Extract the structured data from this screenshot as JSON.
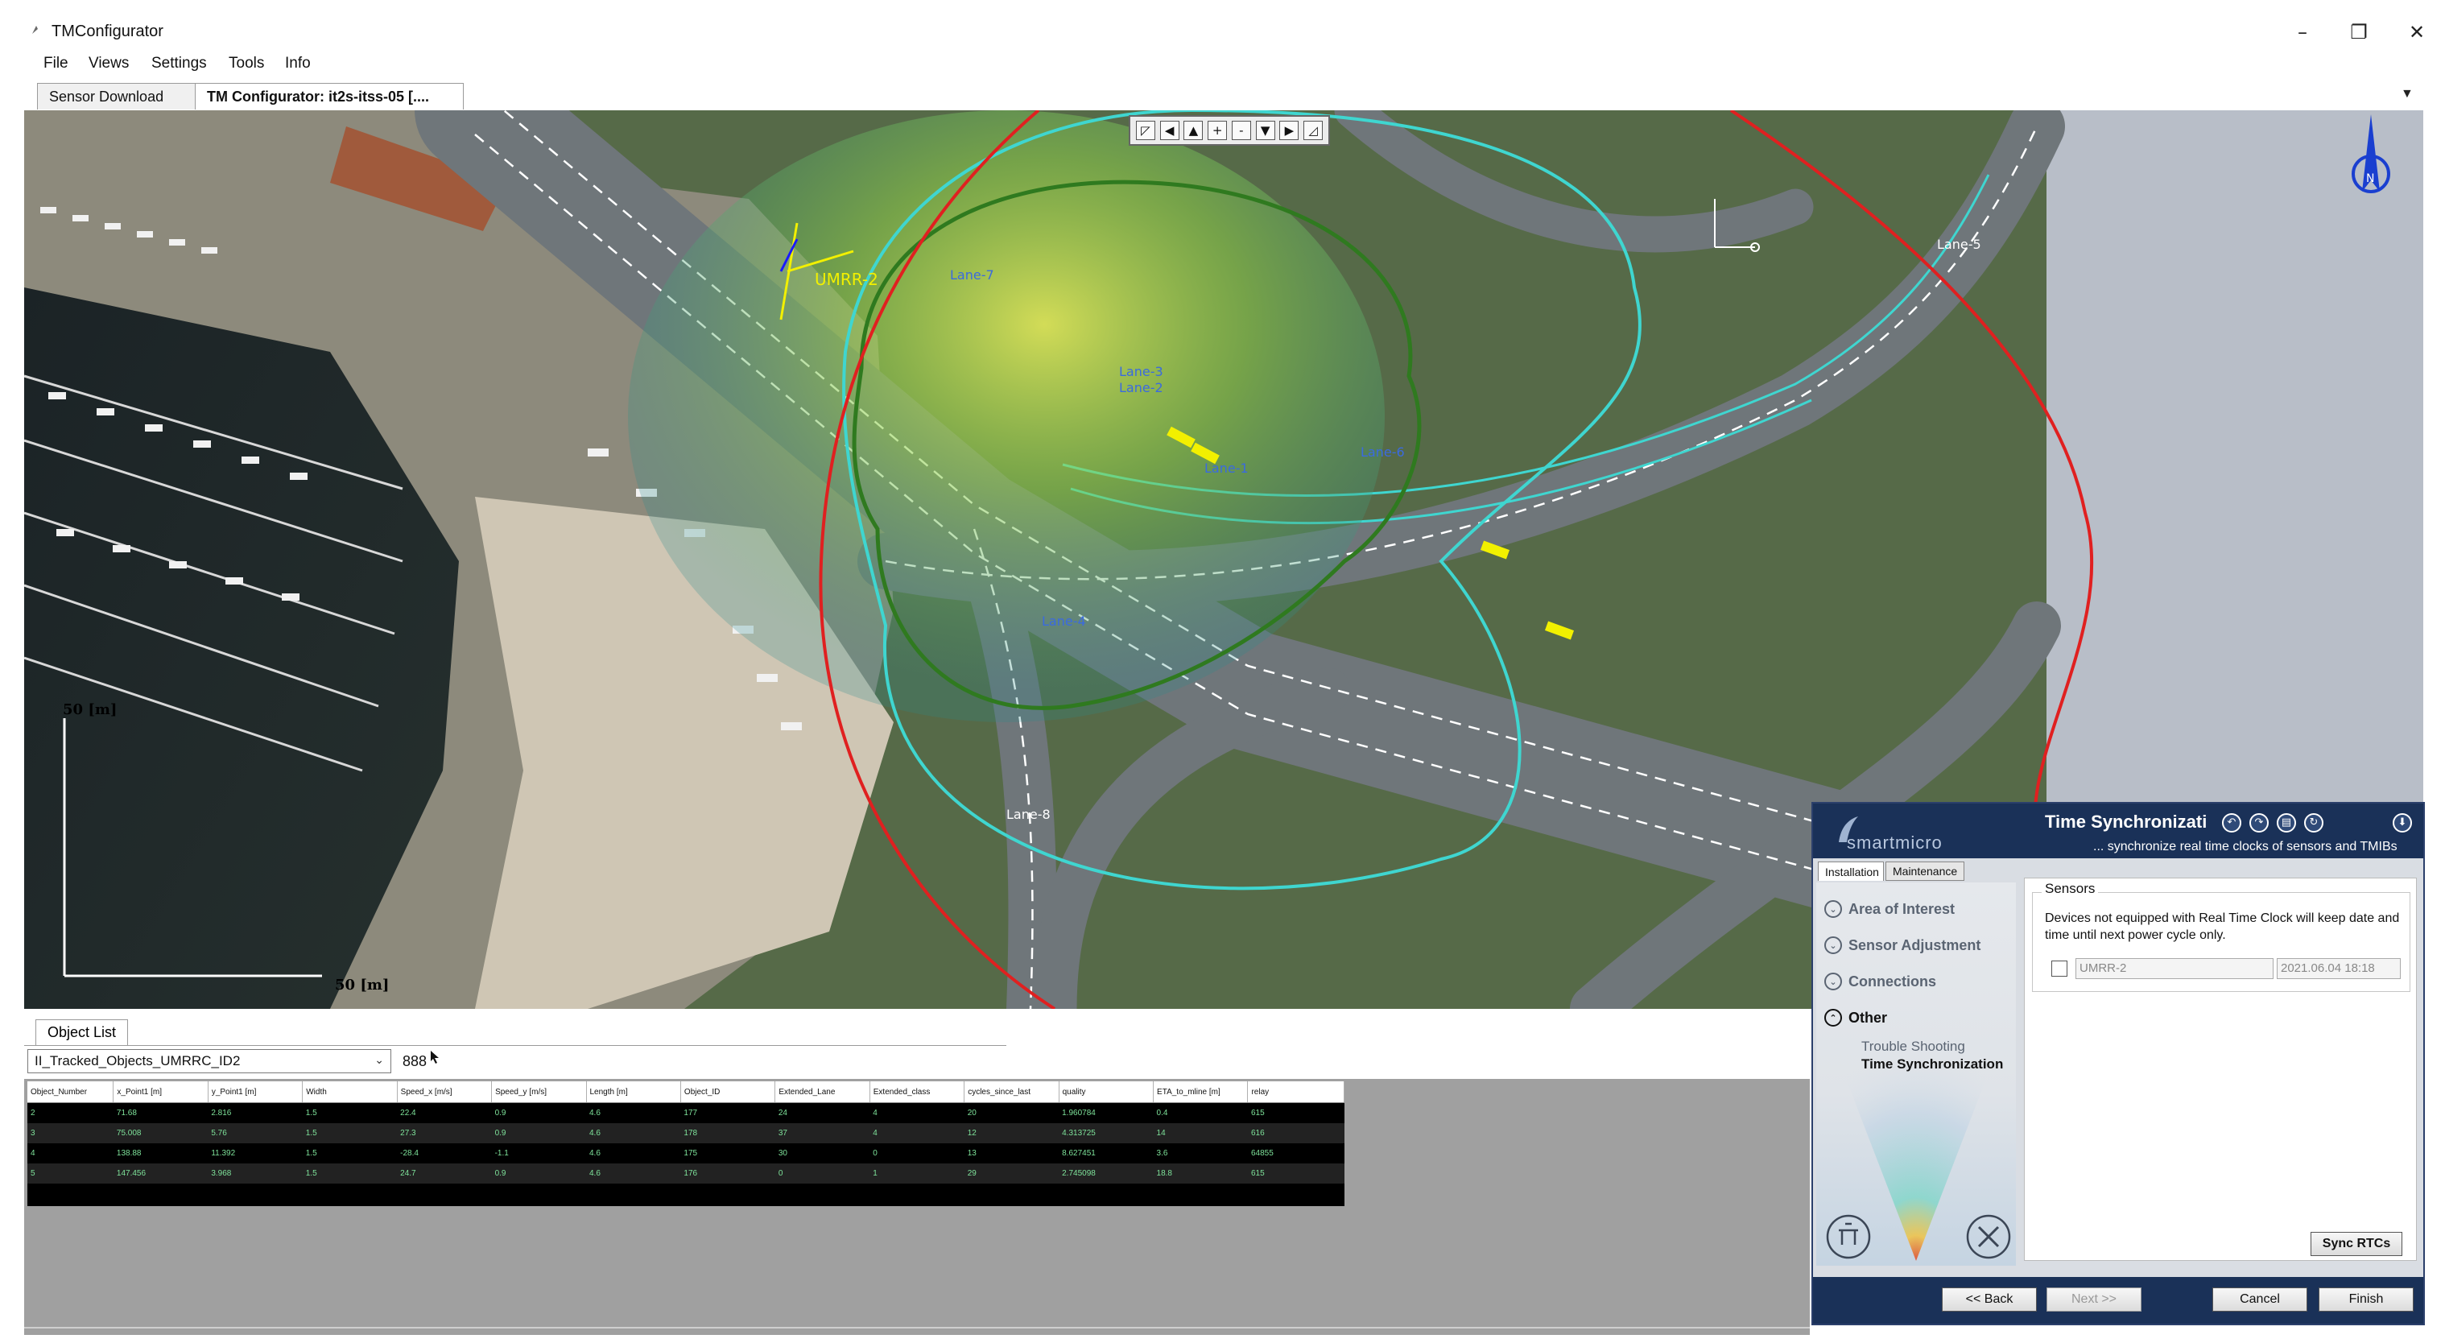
{
  "window": {
    "title": "TMConfigurator",
    "controls": {
      "minimize": "–",
      "restore": "❐",
      "close": "✕"
    }
  },
  "menu": [
    "File",
    "Views",
    "Settings",
    "Tools",
    "Info"
  ],
  "tabs": [
    {
      "label": "Sensor Download",
      "active": false
    },
    {
      "label": "TM Configurator: it2s-itss-05 [....",
      "active": true
    }
  ],
  "tab_overflow_icon": "chevron-down-icon",
  "map": {
    "toolbar_buttons": [
      "◸",
      "◀",
      "▲",
      "+",
      "-",
      "▼",
      "▶",
      "◿"
    ],
    "scale_label_vertical": "50 [m]",
    "scale_label_horizontal": "50 [m]",
    "sensor_label": "UMRR-2",
    "lane_labels": [
      "Lane-7",
      "Lane-5",
      "Lane-6",
      "Lane-3",
      "Lane-2",
      "Lane-1",
      "Lane-8",
      "Lane-4"
    ],
    "compass_label": "N",
    "colors": {
      "fov_red": "#e02020",
      "fov_cyan": "#3fd6d0",
      "fov_green": "#2f7a1f",
      "heat_yellow": "#c8e34a",
      "lanes": "#ffffff"
    }
  },
  "object_list": {
    "tab_label": "Object List",
    "selected_stream": "II_Tracked_Objects_UMRRC_ID2",
    "count": "888",
    "columns": [
      "Object_Number",
      "x_Point1 [m]",
      "y_Point1 [m]",
      "Width",
      "Speed_x [m/s]",
      "Speed_y [m/s]",
      "Length [m]",
      "Object_ID",
      "Extended_Lane",
      "Extended_class",
      "cycles_since_last",
      "quality",
      "ETA_to_mline [m]",
      "relay"
    ],
    "rows": [
      [
        "2",
        "71.68",
        "2.816",
        "1.5",
        "22.4",
        "0.9",
        "4.6",
        "177",
        "24",
        "4",
        "20",
        "1.960784",
        "0.4",
        "615"
      ],
      [
        "3",
        "75.008",
        "5.76",
        "1.5",
        "27.3",
        "0.9",
        "4.6",
        "178",
        "37",
        "4",
        "12",
        "4.313725",
        "14",
        "616"
      ],
      [
        "4",
        "138.88",
        "11.392",
        "1.5",
        "-28.4",
        "-1.1",
        "4.6",
        "175",
        "30",
        "0",
        "13",
        "8.627451",
        "3.6",
        "64855"
      ],
      [
        "5",
        "147.456",
        "3.968",
        "1.5",
        "24.7",
        "0.9",
        "4.6",
        "176",
        "0",
        "1",
        "29",
        "2.745098",
        "18.8",
        "615"
      ]
    ]
  },
  "wizard": {
    "brand": "smartmicro",
    "title": "Time Synchronizati",
    "subtitle": "... synchronize real time clocks of sensors and TMIBs",
    "tabs": [
      "Installation",
      "Maintenance"
    ],
    "nav": [
      {
        "label": "Area of Interest",
        "state": "collapsed"
      },
      {
        "label": "Sensor Adjustment",
        "state": "collapsed"
      },
      {
        "label": "Connections",
        "state": "collapsed"
      },
      {
        "label": "Other",
        "state": "expanded"
      }
    ],
    "subnav": [
      "Trouble Shooting",
      "Time Synchronization"
    ],
    "sensors_group": "Sensors",
    "sensors_desc": "Devices not equipped with Real Time Clock will keep date and time until next power cycle only.",
    "sensor_name": "UMRR-2",
    "sensor_time": "2021.06.04 18:18",
    "sync_button": "Sync RTCs",
    "footer": {
      "back": "<< Back",
      "next": "Next >>",
      "cancel": "Cancel",
      "finish": "Finish"
    }
  }
}
